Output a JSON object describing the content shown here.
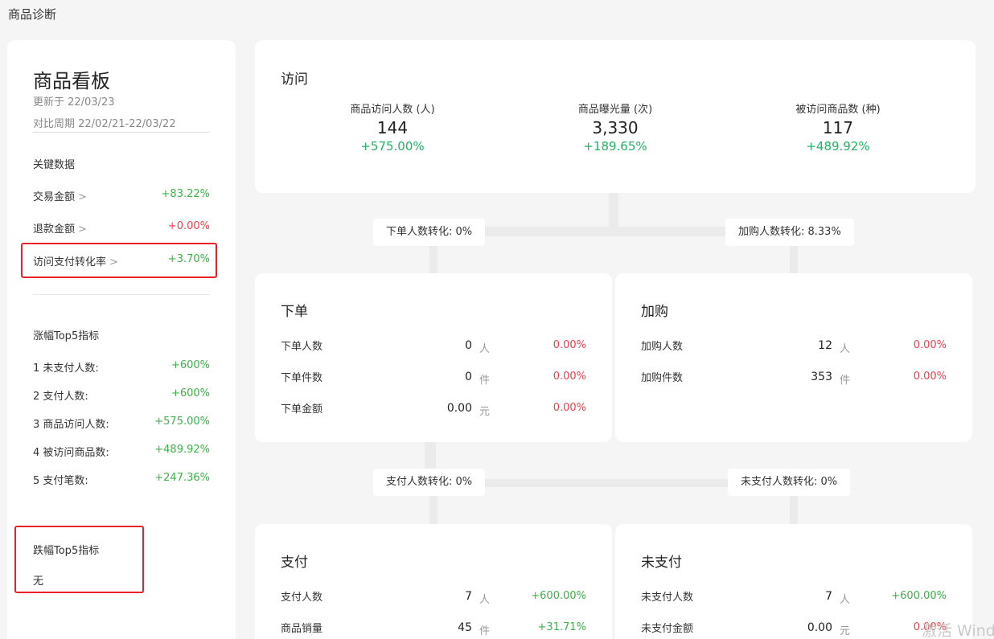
{
  "page_title": "商品诊断",
  "board": {
    "title": "商品看板",
    "updated": "更新于 22/03/23",
    "compare_period": "对比周期 22/02/21-22/03/22"
  },
  "key_data": {
    "title": "关键数据",
    "items": [
      {
        "label": "交易金额",
        "chevron": ">",
        "change": "+83.22%"
      },
      {
        "label": "退款金额",
        "chevron": ">",
        "change": "+0.00%"
      },
      {
        "label": "访问支付转化率",
        "chevron": ">",
        "change": "+3.70%"
      }
    ]
  },
  "rise_top5": {
    "title": "涨幅Top5指标",
    "items": [
      {
        "label": "1  未支付人数:",
        "value": "+600%"
      },
      {
        "label": "2  支付人数:",
        "value": "+600%"
      },
      {
        "label": "3  商品访问人数:",
        "value": "+575.00%"
      },
      {
        "label": "4  被访问商品数:",
        "value": "+489.92%"
      },
      {
        "label": "5  支付笔数:",
        "value": "+247.36%"
      }
    ]
  },
  "fall_top5": {
    "title": "跌幅Top5指标",
    "none_text": "无"
  },
  "visit": {
    "title": "访问",
    "metrics": [
      {
        "label": "商品访问人数 (人)",
        "value": "144",
        "change": "+575.00%"
      },
      {
        "label": "商品曝光量 (次)",
        "value": "3,330",
        "change": "+189.65%"
      },
      {
        "label": "被访问商品数 (种)",
        "value": "117",
        "change": "+489.92%"
      }
    ]
  },
  "conversions": {
    "order": "下单人数转化:  0%",
    "cart": "加购人数转化:  8.33%",
    "pay": "支付人数转化:  0%",
    "unpaid": "未支付人数转化:  0%"
  },
  "order": {
    "title": "下单",
    "rows": [
      {
        "label": "下单人数",
        "value": "0",
        "unit": "人",
        "change": "0.00%"
      },
      {
        "label": "下单件数",
        "value": "0",
        "unit": "件",
        "change": "0.00%"
      },
      {
        "label": "下单金额",
        "value": "0.00",
        "unit": "元",
        "change": "0.00%"
      }
    ]
  },
  "cart": {
    "title": "加购",
    "rows": [
      {
        "label": "加购人数",
        "value": "12",
        "unit": "人",
        "change": "0.00%"
      },
      {
        "label": "加购件数",
        "value": "353",
        "unit": "件",
        "change": "0.00%"
      }
    ]
  },
  "pay": {
    "title": "支付",
    "rows": [
      {
        "label": "支付人数",
        "value": "7",
        "unit": "人",
        "change": "+600.00%"
      },
      {
        "label": "商品销量",
        "value": "45",
        "unit": "件",
        "change": "+31.71%"
      }
    ]
  },
  "unpaid": {
    "title": "未支付",
    "rows": [
      {
        "label": "未支付人数",
        "value": "7",
        "unit": "人",
        "change": "+600.00%"
      },
      {
        "label": "未支付金额",
        "value": "0.00",
        "unit": "元",
        "change": "0.00%"
      }
    ]
  },
  "watermark": "激活 Windows",
  "colors": {
    "positive": "#3db14a",
    "positive_visit": "#1fb561",
    "negative": "#f0414a",
    "highlight_border": "#e8202a"
  }
}
